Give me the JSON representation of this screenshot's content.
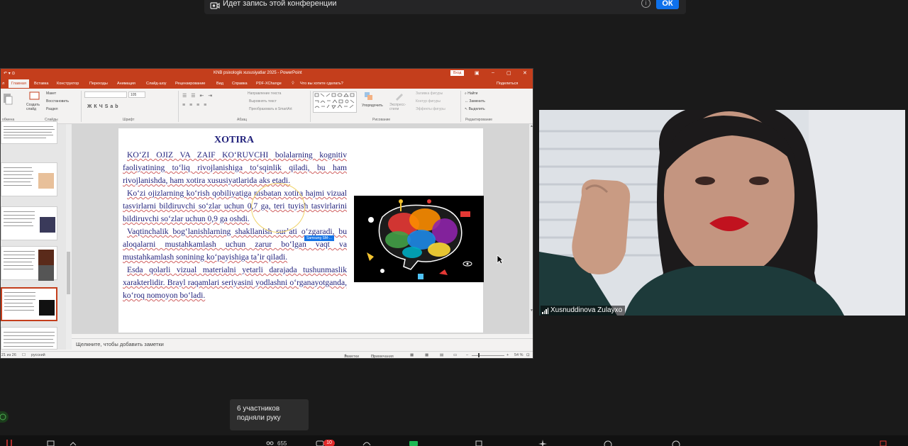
{
  "banner": {
    "text": "Идет запись этой конференции",
    "ok_label": "ОК",
    "info_glyph": "i"
  },
  "ppt": {
    "window_title": "KNB psixologik xususiyatlar 2025  -  PowerPoint",
    "signin_label": "Вход",
    "tabs": [
      "Главная",
      "Вставка",
      "Конструктор",
      "Переходы",
      "Анимация",
      "Слайд-шоу",
      "Рецензирование",
      "Вид",
      "Справка",
      "PDF-XChange"
    ],
    "tell_me": "Что вы хотите сделать?",
    "share": "Поделиться",
    "ribbon": {
      "layout": "Макет",
      "reset": "Восстановить",
      "section": "Раздел",
      "create_slide": "Создать слайд",
      "font_size": "105",
      "groups": [
        "Слайды",
        "Шрифт",
        "Абзац",
        "Рисование",
        "Редактирование"
      ],
      "text_direction": "Направление текста",
      "align_text": "Выровнять текст",
      "smartart": "Преобразовать в SmartArt",
      "arrange": "Упорядочить",
      "quick_styles": "Экспресс-стили",
      "shape_fill": "Заливка фигуры",
      "shape_outline": "Контур фигуры",
      "shape_effects": "Эффекты фигуры",
      "find": "Найти",
      "replace": "Заменить",
      "select": "Выделить",
      "group_buffer": "обмена"
    },
    "slide": {
      "title": "XOTIRA",
      "paragraphs": [
        "KOʻZI OJIZ VA ZAIF KOʻRUVCHI bolalarning kognitiv faoliyatining toʻliq rivojlanishiga toʻsqinlik qiladi, bu ham rivojlanishda, ham xotira xususiyatlarida aks etadi.",
        "Koʻzi ojizlarning koʻrish qobiliyatiga nisbatan xotira hajmi vizual tasvirlarni bildiruvchi soʻzlar uchun 0,7 ga, teri tuyish tasvirlarini bildiruvchi soʻzlar uchun 0,9 ga oshdi.",
        "Vaqtinchalik bogʻlanishlarning shakllanish surʼati oʻzgaradi, bu aloqalarni mustahkamlash uchun zarur boʻlgan vaqt va mustahkamlash sonining koʻpayishiga taʼir qiladi.",
        "Esda qolarli vizual materialni yetarli darajada tushunmaslik xarakterlidir. Brayl raqamlari seriyasini yodlashni oʻrganayotganda, koʻroq nomoyon boʻladi."
      ],
      "tooltip": "Samsung SM-..."
    },
    "notes_placeholder": "Щелкните, чтобы добавить заметки",
    "status": {
      "slide_info": "21 из 26",
      "language": "русский",
      "notes": "Заметки",
      "comments": "Примечания",
      "zoom": "54 %"
    }
  },
  "video": {
    "participant_name": "Xusnuddinova Zulayxo"
  },
  "toast": {
    "text": "6 участников подняли руку"
  },
  "bottom_bar": {
    "participants_count": "655",
    "chat_badge": "10"
  },
  "colors": {
    "ppt_accent": "#c43e1c",
    "zoom_blue": "#0e71eb",
    "slide_text": "#1f1f7a"
  }
}
